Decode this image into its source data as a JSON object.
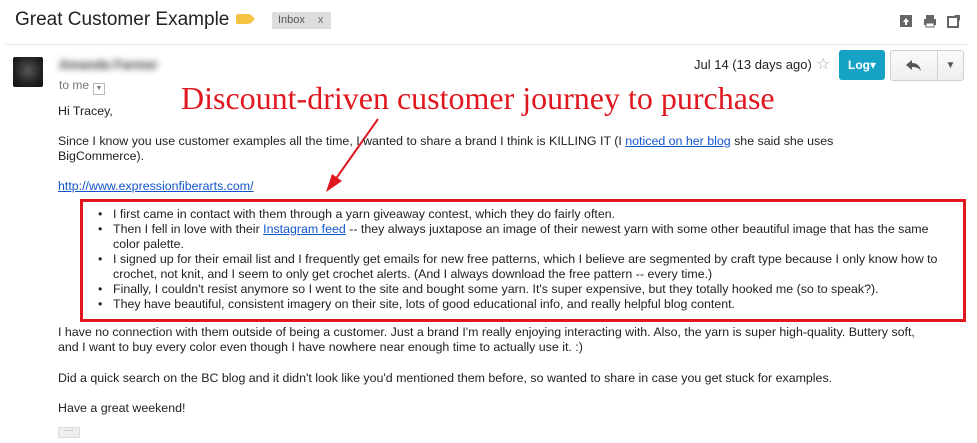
{
  "thread": {
    "subject": "Great Customer Example",
    "label_chip": "Inbox",
    "label_chip_close": "x",
    "label_color": "#f5c242",
    "icons": [
      "archive-icon",
      "print-icon",
      "open-new-window-icon"
    ]
  },
  "message": {
    "sender_name": "Amanda Farmer",
    "to_line": "to me",
    "date": "Jul 14 (13 days ago)",
    "log_button": "Log",
    "log_button_color": "#15a2c5",
    "greeting": "Hi Tracey,",
    "para1_before_link": "Since I know you use customer examples all the time, I wanted to share a brand I think is KILLING IT (I ",
    "para1_link": "noticed on her blog",
    "para1_after_link": " she said she uses BigCommerce).",
    "site_url": "http://www.expressionfiberarts.com/",
    "bullet1": "I first came in contact with them through a yarn giveaway contest, which they do fairly often.",
    "bullet2_before_link": "Then I fell in love with their ",
    "bullet2_link": "Instagram feed",
    "bullet2_after_link": " -- they always juxtapose an image of their newest yarn with some other beautiful image that has the same color palette.",
    "bullet3": "I signed up for their email list and I frequently get emails for new free patterns, which I believe are segmented by craft type because I only know how to crochet, not knit, and I seem to only get crochet alerts. (And I always download the free pattern -- every time.)",
    "bullet4": "Finally, I couldn't resist anymore so I went to the site and bought some yarn. It's super expensive, but they totally hooked me (so to speak?).",
    "bullet5": "They have beautiful, consistent imagery on their site, lots of good educational info, and really helpful blog content.",
    "para2": "I have no connection with them outside of being a customer. Just a brand I'm really enjoying interacting with. Also, the yarn is super high-quality. Buttery soft, and I want to buy every color even though I have nowhere near enough time to actually use it. :)",
    "para3": "Did a quick search on the BC blog and it didn't look like you'd mentioned them before, so wanted to share in case you get stuck for examples.",
    "para4": "Have a great weekend!",
    "trimmed_content": "···"
  },
  "annotation": {
    "text": "Discount-driven customer journey to purchase",
    "color": "#e0171f"
  }
}
